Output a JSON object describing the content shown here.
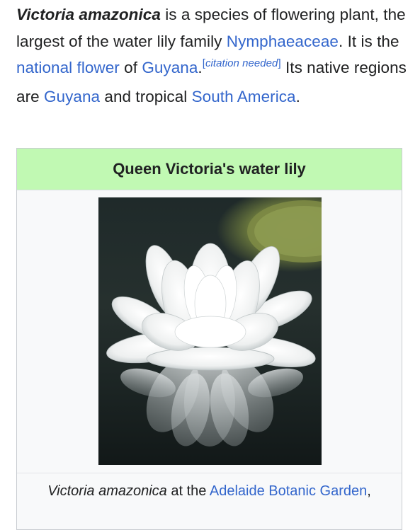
{
  "article": {
    "intro": {
      "species": "Victoria amazonica",
      "text1": " is a species of flowering plant, the largest of the water lily family ",
      "link_family": "Nymphaeaceae",
      "text2": ". It is the ",
      "link_national_flower": "national flower",
      "text3": " of ",
      "link_guyana_1": "Guyana",
      "text4": ".",
      "citation": "citation needed",
      "text5": " Its native regions are ",
      "link_guyana_2": "Guyana",
      "text6": " and tropical ",
      "link_south_america": "South America",
      "text7": "."
    }
  },
  "infobox": {
    "title": "Queen Victoria's water lily",
    "image_alt": "Victoria amazonica flower",
    "caption": {
      "species": "Victoria amazonica",
      "text": " at the ",
      "link_garden": "Adelaide Botanic Garden",
      "trailing": ","
    }
  },
  "colors": {
    "link": "#3366cc",
    "infobox_header": "#c1f9b3",
    "infobox_bg": "#f8f9fa",
    "text": "#202122"
  }
}
